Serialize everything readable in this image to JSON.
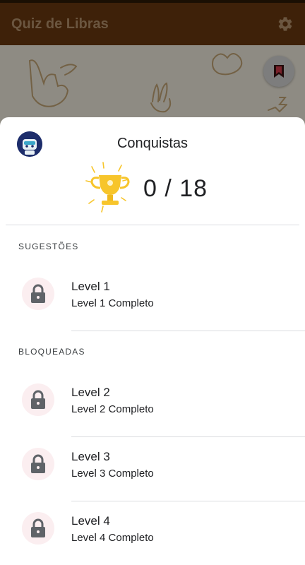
{
  "app_bar": {
    "title": "Quiz de Libras",
    "settings_icon": "gear-icon"
  },
  "colors": {
    "app_bar": "#6b3a10",
    "title_text": "#b9956f",
    "lock_bg": "#fbeef0",
    "lock_icon": "#5f6368",
    "trophy": "#f7c52b"
  },
  "achievements": {
    "title": "Conquistas",
    "score": "0 / 18",
    "sections": [
      {
        "label": "SUGESTÕES",
        "items": [
          {
            "title": "Level 1",
            "subtitle": "Level 1 Completo",
            "icon": "lock-icon"
          }
        ]
      },
      {
        "label": "BLOQUEADAS",
        "items": [
          {
            "title": "Level 2",
            "subtitle": "Level 2 Completo",
            "icon": "lock-icon"
          },
          {
            "title": "Level 3",
            "subtitle": "Level 3 Completo",
            "icon": "lock-icon"
          },
          {
            "title": "Level 4",
            "subtitle": "Level 4 Completo",
            "icon": "lock-icon"
          }
        ]
      }
    ]
  }
}
